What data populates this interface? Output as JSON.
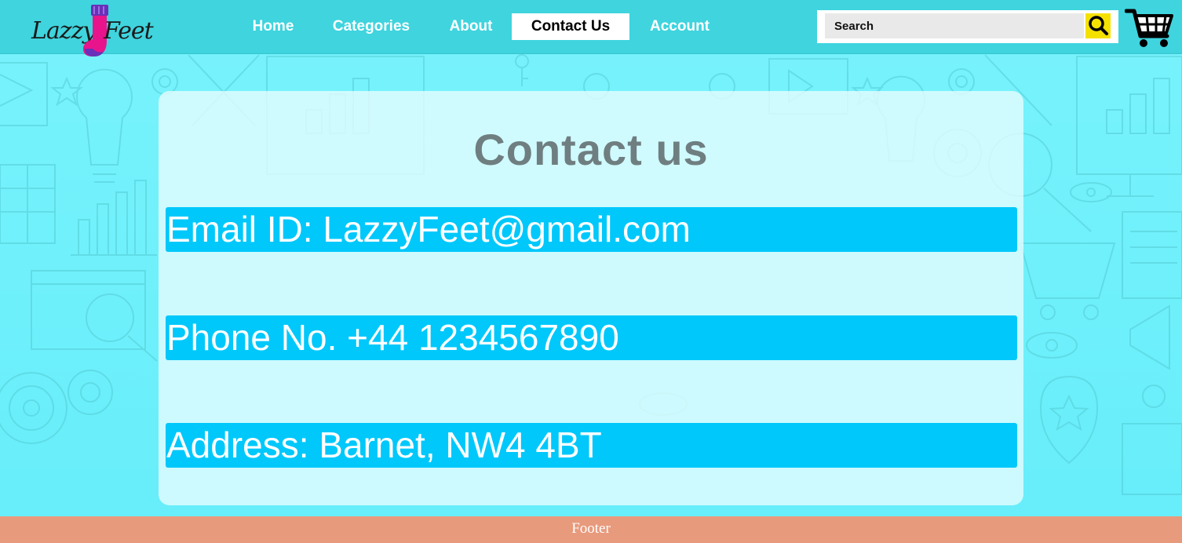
{
  "brand": {
    "logo_left": "Lazzy",
    "logo_right": "Feet"
  },
  "nav": {
    "items": [
      {
        "label": "Home"
      },
      {
        "label": "Categories"
      },
      {
        "label": "About"
      },
      {
        "label": "Contact Us",
        "active": true
      },
      {
        "label": "Account"
      }
    ]
  },
  "search": {
    "placeholder": "Search",
    "value": ""
  },
  "icons": {
    "search": "search-icon",
    "cart": "cart-icon",
    "logo": "sock-logo-icon"
  },
  "contact": {
    "title": "Contact us",
    "email": "Email ID: LazzyFeet@gmail.com",
    "phone": "Phone No. +44 1234567890",
    "address": "Address: Barnet, NW4 4BT"
  },
  "footer": {
    "label": "Footer"
  },
  "colors": {
    "navbar": "#3fd4de",
    "background": "#6ff0fb",
    "info_bar": "#00c8fb",
    "footer": "#e89a7c",
    "search_button": "#f5e100",
    "sock": "#e8148c"
  }
}
